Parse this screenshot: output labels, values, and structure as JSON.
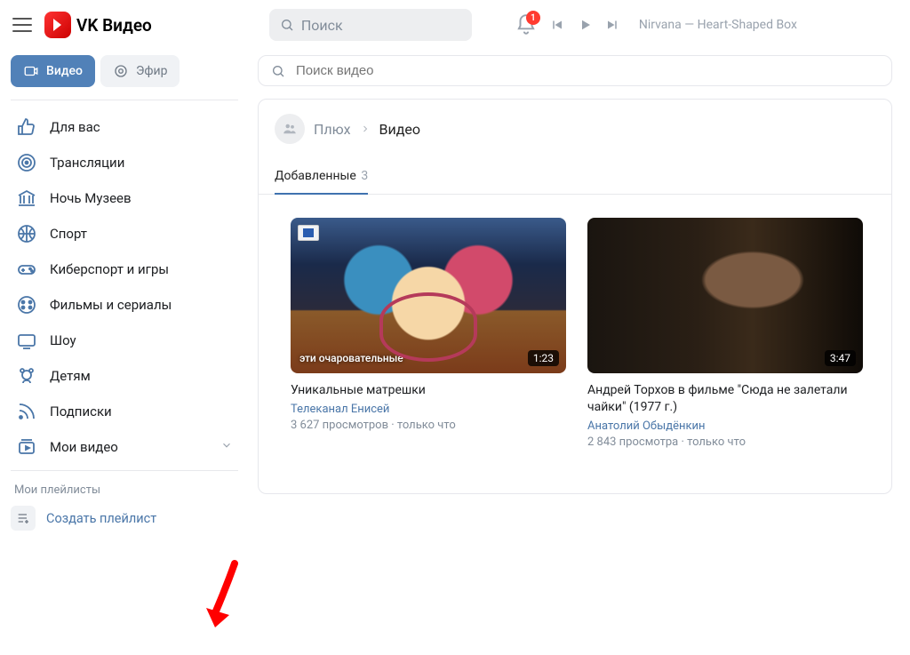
{
  "header": {
    "app_name": "VK Видео",
    "search_placeholder": "Поиск",
    "notification_count": "1",
    "now_playing": "Nirvana — Heart-Shaped Box"
  },
  "sidebar": {
    "tabs": {
      "video": "Видео",
      "live": "Эфир"
    },
    "items": [
      {
        "label": "Для вас",
        "icon": "thumbs-up-icon"
      },
      {
        "label": "Трансляции",
        "icon": "target-icon"
      },
      {
        "label": "Ночь Музеев",
        "icon": "museum-icon"
      },
      {
        "label": "Спорт",
        "icon": "basketball-icon"
      },
      {
        "label": "Киберспорт и игры",
        "icon": "gamepad-icon"
      },
      {
        "label": "Фильмы и сериалы",
        "icon": "film-icon"
      },
      {
        "label": "Шоу",
        "icon": "tv-icon"
      },
      {
        "label": "Детям",
        "icon": "teddy-icon"
      },
      {
        "label": "Подписки",
        "icon": "rss-icon"
      },
      {
        "label": "Мои видео",
        "icon": "my-video-icon",
        "expandable": true
      }
    ],
    "section_label": "Мои плейлисты",
    "create_playlist": "Создать плейлист"
  },
  "main": {
    "search_placeholder": "Поиск видео",
    "breadcrumb": {
      "group": "Плюх",
      "current": "Видео"
    },
    "tab": {
      "label": "Добавленные",
      "count": "3"
    },
    "cards": [
      {
        "title": "Уникальные матрешки",
        "author": "Телеканал Енисей",
        "views": "3 627 просмотров",
        "time": "только что",
        "duration": "1:23",
        "overlay": "эти очаровательные"
      },
      {
        "title": "Андрей Торхов в фильме \"Сюда не залетали чайки\" (1977 г.)",
        "author": "Анатолий Обыдёнкин",
        "views": "2 843 просмотра",
        "time": "только что",
        "duration": "3:47"
      }
    ]
  }
}
